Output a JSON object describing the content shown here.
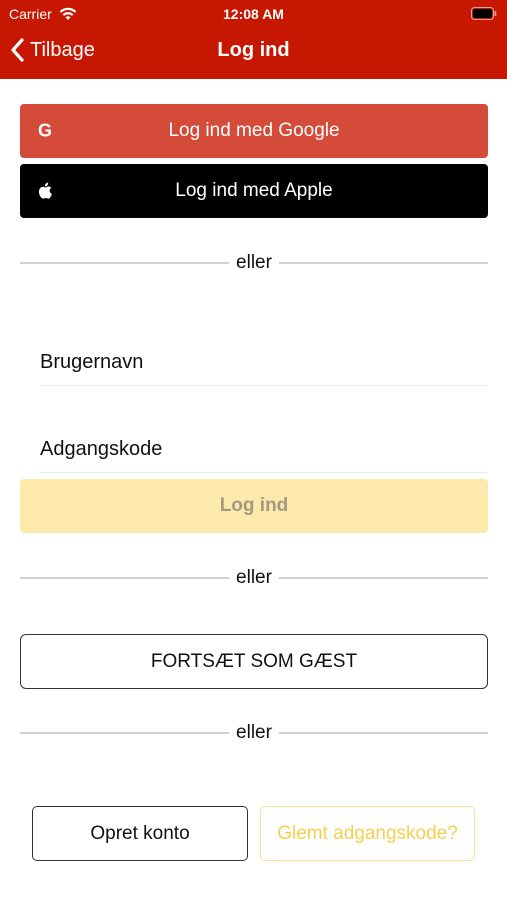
{
  "status_bar": {
    "carrier": "Carrier",
    "time": "12:08 AM"
  },
  "navbar": {
    "back_label": "Tilbage",
    "title": "Log ind"
  },
  "social": {
    "google_label": "Log ind med Google",
    "google_icon": "G",
    "apple_label": "Log ind med Apple"
  },
  "separator_text": "eller",
  "form": {
    "username_placeholder": "Brugernavn",
    "password_placeholder": "Adgangskode",
    "login_label": "Log ind"
  },
  "guest_label": "FORTSÆT SOM GÆST",
  "footer": {
    "create_account_label": "Opret konto",
    "forgot_password_label": "Glemt adgangskode?"
  },
  "colors": {
    "header": "#c81700",
    "google": "#d54b39",
    "apple": "#000000",
    "login_disabled": "#fde9ab",
    "forgot_accent": "#f5cf4f"
  }
}
